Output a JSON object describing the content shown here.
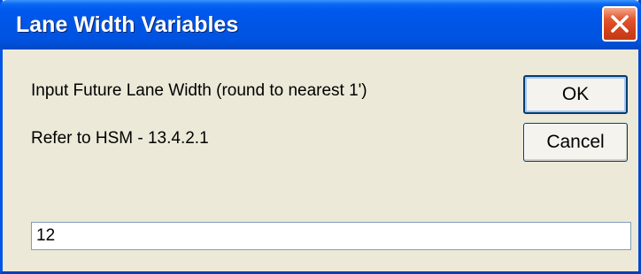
{
  "window": {
    "title": "Lane Width Variables"
  },
  "prompt": {
    "line1": "Input Future Lane Width (round to nearest 1')",
    "line2": "Refer to HSM - 13.4.2.1"
  },
  "buttons": {
    "ok_label": "OK",
    "cancel_label": "Cancel"
  },
  "input": {
    "value": "12"
  },
  "icons": {
    "close": "close-icon"
  },
  "colors": {
    "titlebar": "#0055e5",
    "close_button": "#d2411b",
    "dialog_background": "#ece9d8"
  }
}
